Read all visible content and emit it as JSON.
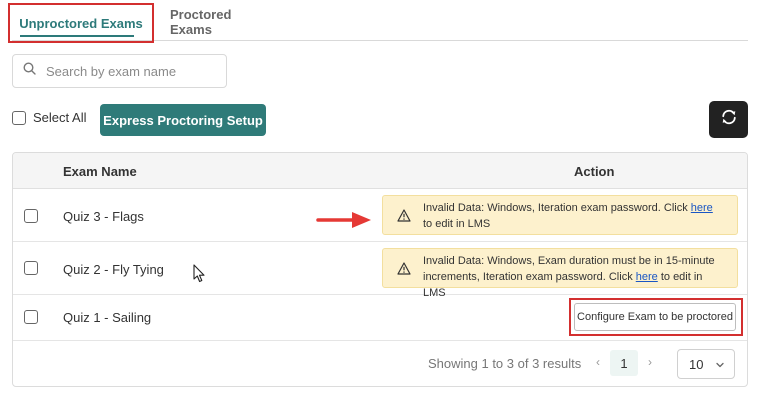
{
  "tabs": [
    {
      "label": "Unproctored Exams",
      "active": true
    },
    {
      "label": "Proctored Exams",
      "active": false
    }
  ],
  "search": {
    "placeholder": "Search by exam name",
    "icon": "search-icon"
  },
  "toolbar": {
    "select_all_label": "Select All",
    "express_setup_label": "Express Proctoring Setup",
    "refresh_icon": "refresh-icon"
  },
  "table": {
    "headers": {
      "name": "Exam Name",
      "action": "Action"
    },
    "rows": [
      {
        "name": "Quiz 3 - Flags",
        "warning": {
          "prefix": "Invalid Data: Windows, Iteration exam password. Click ",
          "link": "here",
          "suffix": " to edit in LMS"
        }
      },
      {
        "name": "Quiz 2 - Fly Tying",
        "warning": {
          "prefix": "Invalid Data: Windows, Exam duration must be in 15-minute increments, Iteration exam password. Click ",
          "link": "here",
          "suffix": " to edit in LMS"
        }
      },
      {
        "name": "Quiz 1 - Sailing",
        "action_button": "Configure Exam to be proctored"
      }
    ]
  },
  "footer": {
    "showing": "Showing 1 to 3 of 3 results",
    "prev": "‹",
    "page": "1",
    "next": "›",
    "per_page": "10"
  },
  "colors": {
    "accent": "#2f7b79",
    "highlight": "#d32f2f",
    "warning_bg": "#fdf1cd",
    "link": "#1a56c4"
  }
}
